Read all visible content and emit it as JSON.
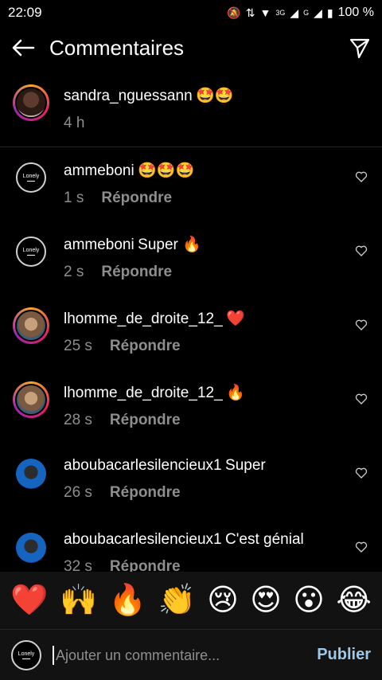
{
  "status": {
    "time": "22:09",
    "battery": "100 %",
    "network_small": "3G",
    "network_g": "G"
  },
  "header": {
    "title": "Commentaires"
  },
  "caption": {
    "username": "sandra_nguessann",
    "text": "🤩🤩",
    "time": "4 h"
  },
  "comments": [
    {
      "username": "ammeboni",
      "text": "🤩🤩🤩",
      "time": "1 s",
      "reply": "Répondre"
    },
    {
      "username": "ammeboni",
      "text": "Super 🔥",
      "time": "2 s",
      "reply": "Répondre"
    },
    {
      "username": "lhomme_de_droite_12_",
      "text": "❤️",
      "time": "25 s",
      "reply": "Répondre"
    },
    {
      "username": "lhomme_de_droite_12_",
      "text": "🔥",
      "time": "28 s",
      "reply": "Répondre"
    },
    {
      "username": "aboubacarlesilencieux1",
      "text": "Super",
      "time": "26 s",
      "reply": "Répondre"
    },
    {
      "username": "aboubacarlesilencieux1",
      "text": "C'est génial",
      "time": "32 s",
      "reply": "Répondre"
    }
  ],
  "emojis": [
    "❤️",
    "🙌",
    "🔥",
    "👏",
    "😢",
    "😍",
    "😮",
    "😂"
  ],
  "composer": {
    "placeholder": "Ajouter un commentaire...",
    "publish": "Publier",
    "avatar_text": "Lonely"
  }
}
